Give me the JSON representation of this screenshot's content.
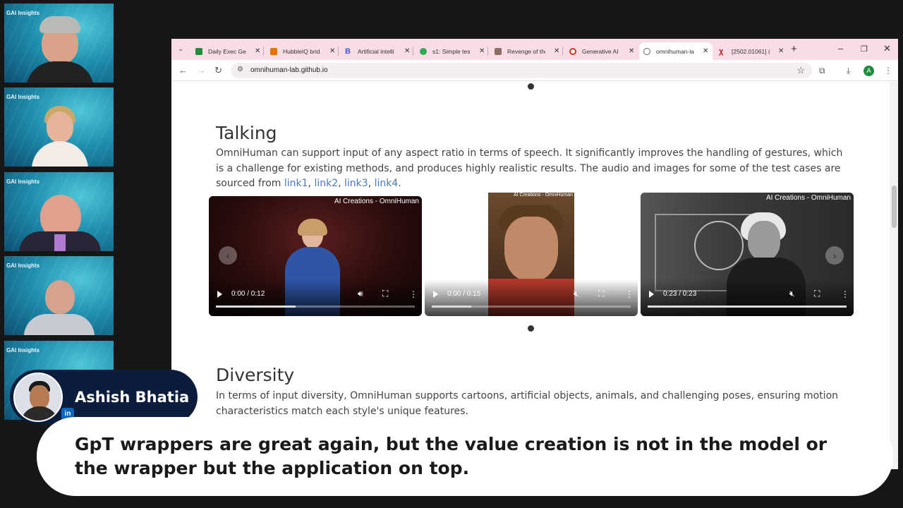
{
  "tiles": [
    {
      "label": "GAI Insights"
    },
    {
      "label": "GAI Insights"
    },
    {
      "label": "GAI Insights"
    },
    {
      "label": "GAI Insights"
    },
    {
      "label": "GAI Insights"
    }
  ],
  "browser": {
    "tabs": [
      {
        "title": "Daily Exec Ger",
        "icon": "sheets-icon",
        "color": "#1e8e3e"
      },
      {
        "title": "HubbleIQ brid",
        "icon": "cube-icon",
        "color": "#e8710a"
      },
      {
        "title": "Artificial intelli",
        "icon": "b-icon",
        "color": "#3b5bdb"
      },
      {
        "title": "s1: Simple test",
        "icon": "emoji-icon",
        "color": "#34a853"
      },
      {
        "title": "Revenge of the",
        "icon": "portrait-icon",
        "color": "#8d6e63"
      },
      {
        "title": "Generative AI",
        "icon": "clock-icon",
        "color": "#d93025"
      },
      {
        "title": "omnihuman-la",
        "icon": "globe-icon",
        "color": "#5f6368"
      },
      {
        "title": "[2502.01061] (",
        "icon": "arxiv-icon",
        "color": "#b31b1b"
      }
    ],
    "url": "omnihuman-lab.github.io"
  },
  "page": {
    "section1": {
      "heading": "Talking",
      "text": "OmniHuman can support input of any aspect ratio in terms of speech. It significantly improves the handling of gestures, which is a challenge for existing methods, and produces highly realistic results. The audio and images for some of the test cases are sourced from ",
      "links": [
        "link1",
        "link2",
        "link3",
        "link4"
      ],
      "period": "."
    },
    "videos": [
      {
        "watermark": "AI Creations - OmniHuman",
        "time": "0:00 / 0:12",
        "progress": 0.4
      },
      {
        "watermark": "AI Creations - OmniHuman",
        "time": "0:00 / 0:15",
        "progress": 0.2
      },
      {
        "watermark": "AI Creations - OmniHuman",
        "time": "0:23 / 0:23",
        "progress": 1.0
      }
    ],
    "section2": {
      "heading": "Diversity",
      "text": "In terms of input diversity, OmniHuman supports cartoons, artificial objects, animals, and challenging poses, ensuring motion characteristics match each style's unique features."
    }
  },
  "speaker": {
    "name": "Ashish Bhatia",
    "social": "in"
  },
  "caption": "GpT wrappers are great again, but the value creation is not in the model or the wrapper but the application on top."
}
